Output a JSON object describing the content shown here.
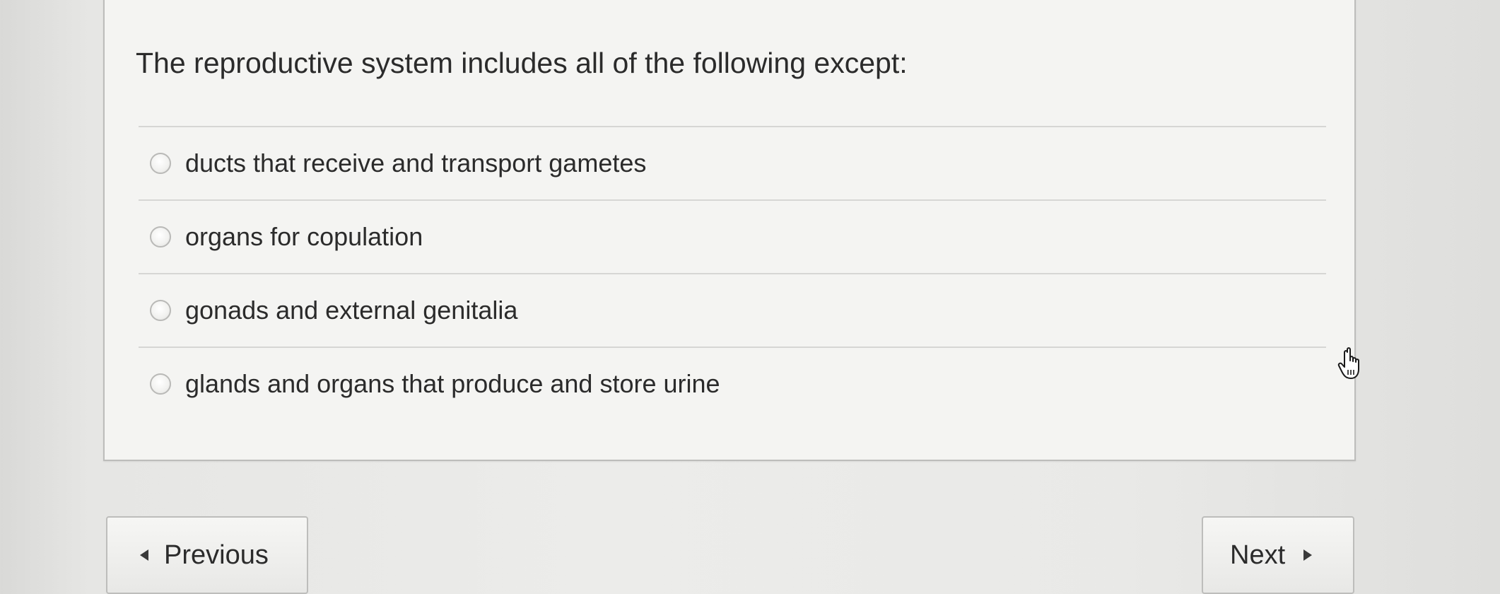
{
  "question": {
    "text": "The reproductive system includes all of the following except:"
  },
  "options": [
    {
      "label": "ducts that receive and transport gametes",
      "selected": false
    },
    {
      "label": "organs for copulation",
      "selected": false
    },
    {
      "label": "gonads and external genitalia",
      "selected": false
    },
    {
      "label": "glands and organs that produce and store urine",
      "selected": false
    }
  ],
  "navigation": {
    "previous_label": "Previous",
    "next_label": "Next"
  },
  "icons": {
    "cursor": "hand-pointer-icon",
    "previous_arrow": "triangle-left-icon",
    "next_arrow": "triangle-right-icon",
    "radio": "radio-button-icon"
  }
}
